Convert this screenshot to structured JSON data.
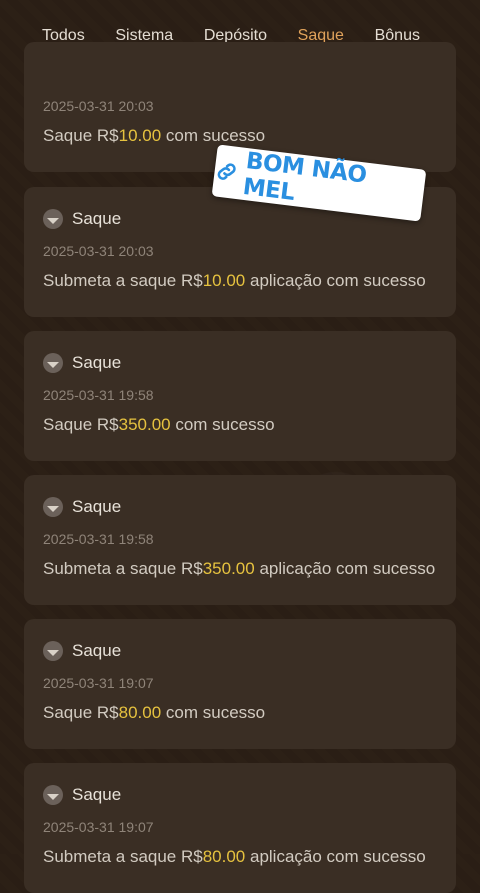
{
  "tabs": [
    {
      "label": "Todos"
    },
    {
      "label": "Sistema"
    },
    {
      "label": "Depósito"
    },
    {
      "label": "Saque"
    },
    {
      "label": "Bônus"
    }
  ],
  "active_tab": "Saque",
  "accent_color": "#e0a25b",
  "amount_color": "#e6c23f",
  "sticker": {
    "text": "BOM NÃO MEL",
    "icon": "link-icon"
  },
  "cards": [
    {
      "title": "",
      "date": "2025-03-31 20:03",
      "pre": "Saque R$",
      "amount": "10.00",
      "post": " com sucesso"
    },
    {
      "title": "Saque",
      "date": "2025-03-31 20:03",
      "pre": "Submeta a saque R$",
      "amount": "10.00",
      "post": " aplicação com sucesso"
    },
    {
      "title": "Saque",
      "date": "2025-03-31 19:58",
      "pre": "Saque R$",
      "amount": "350.00",
      "post": " com sucesso"
    },
    {
      "title": "Saque",
      "date": "2025-03-31 19:58",
      "pre": "Submeta a saque R$",
      "amount": "350.00",
      "post": " aplicação com sucesso"
    },
    {
      "title": "Saque",
      "date": "2025-03-31 19:07",
      "pre": "Saque R$",
      "amount": "80.00",
      "post": " com sucesso"
    },
    {
      "title": "Saque",
      "date": "2025-03-31 19:07",
      "pre": "Submeta a saque R$",
      "amount": "80.00",
      "post": " aplicação com sucesso"
    }
  ]
}
